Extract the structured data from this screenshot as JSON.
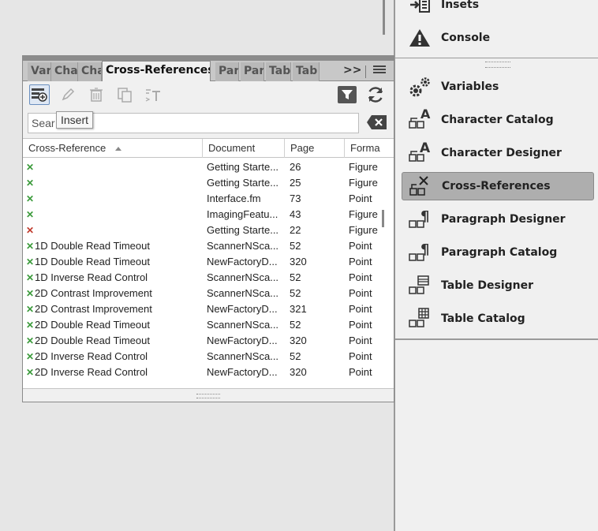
{
  "colors": {
    "green_mark": "#3a9a3a",
    "red_mark": "#c0392b",
    "selected_item_bg": "#aeaeae"
  },
  "right_panel": {
    "items": [
      {
        "label": "Insets",
        "icon": "insets-icon"
      },
      {
        "label": "Console",
        "icon": "warning-triangle-icon"
      },
      {
        "label": "Variables",
        "icon": "gears-icon"
      },
      {
        "label": "Character Catalog",
        "icon": "character-catalog-icon"
      },
      {
        "label": "Character Designer",
        "icon": "character-designer-icon"
      },
      {
        "label": "Cross-References",
        "icon": "cross-references-icon",
        "selected": true
      },
      {
        "label": "Paragraph Designer",
        "icon": "paragraph-designer-icon"
      },
      {
        "label": "Paragraph Catalog",
        "icon": "paragraph-catalog-icon"
      },
      {
        "label": "Table Designer",
        "icon": "table-designer-icon"
      },
      {
        "label": "Table Catalog",
        "icon": "table-catalog-icon"
      }
    ]
  },
  "pod": {
    "tabs": [
      "Var",
      "Cha",
      "Cha",
      "Cross-References",
      "Par",
      "Par",
      "Tab",
      "Tab"
    ],
    "more_label": ">>",
    "toolbar": {
      "buttons": [
        "insert",
        "edit",
        "delete",
        "duplicate",
        "convert-to-text"
      ],
      "right_buttons": [
        "filter",
        "refresh"
      ]
    },
    "search": {
      "value": "Sear",
      "tooltip": "Insert"
    },
    "table": {
      "columns": [
        "Cross-Reference",
        "Document",
        "Page",
        "Forma"
      ],
      "rows": [
        {
          "status": "ok",
          "name": "",
          "document": "Getting Starte...",
          "page": "26",
          "format": "Figure"
        },
        {
          "status": "ok",
          "name": "",
          "document": "Getting Starte...",
          "page": "25",
          "format": "Figure"
        },
        {
          "status": "ok",
          "name": "",
          "document": "Interface.fm",
          "page": "73",
          "format": "Point"
        },
        {
          "status": "ok",
          "name": "",
          "document": "ImagingFeatu...",
          "page": "43",
          "format": "Figure"
        },
        {
          "status": "bad",
          "name": "",
          "document": "Getting Starte...",
          "page": "22",
          "format": "Figure"
        },
        {
          "status": "ok",
          "name": "1D Double Read Timeout",
          "document": "ScannerNSca...",
          "page": "52",
          "format": "Point"
        },
        {
          "status": "ok",
          "name": "1D Double Read Timeout",
          "document": "NewFactoryD...",
          "page": "320",
          "format": "Point"
        },
        {
          "status": "ok",
          "name": "1D Inverse Read Control",
          "document": "ScannerNSca...",
          "page": "52",
          "format": "Point"
        },
        {
          "status": "ok",
          "name": "2D Contrast Improvement",
          "document": "ScannerNSca...",
          "page": "52",
          "format": "Point"
        },
        {
          "status": "ok",
          "name": "2D Contrast Improvement",
          "document": "NewFactoryD...",
          "page": "321",
          "format": "Point"
        },
        {
          "status": "ok",
          "name": "2D Double Read Timeout",
          "document": "ScannerNSca...",
          "page": "52",
          "format": "Point"
        },
        {
          "status": "ok",
          "name": "2D Double Read Timeout",
          "document": "NewFactoryD...",
          "page": "320",
          "format": "Point"
        },
        {
          "status": "ok",
          "name": "2D Inverse Read Control",
          "document": "ScannerNSca...",
          "page": "52",
          "format": "Point"
        },
        {
          "status": "ok",
          "name": "2D Inverse Read Control",
          "document": "NewFactoryD...",
          "page": "320",
          "format": "Point"
        }
      ]
    }
  }
}
